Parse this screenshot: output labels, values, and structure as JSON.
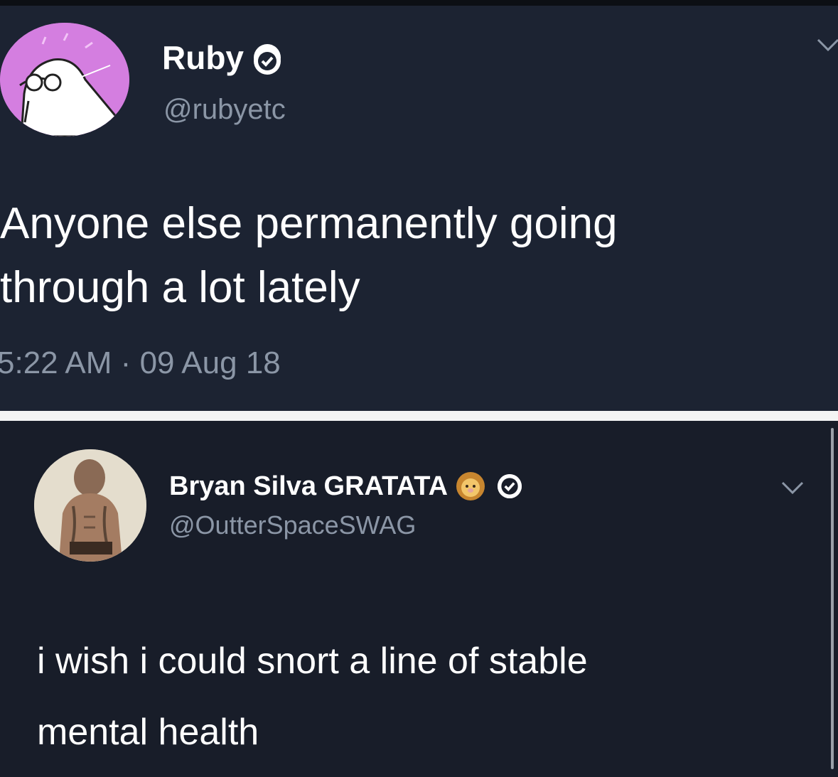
{
  "tweets": [
    {
      "display_name": "Ruby",
      "handle": "@rubyetc",
      "text_lines": [
        "Anyone else permanently going",
        "through a lot lately"
      ],
      "time": "5:22 AM",
      "separator": "·",
      "date": "09 Aug 18",
      "verified": true
    },
    {
      "display_name": "Bryan Silva GRATATA",
      "handle": "@OutterSpaceSWAG",
      "text_lines": [
        "i wish i could snort a line of stable",
        "mental health"
      ],
      "verified": true
    }
  ],
  "icons": {
    "verified": "verified-check-icon",
    "menu": "chevron-down-icon",
    "emoji": "lion-face-emoji"
  },
  "colors": {
    "background_top": "#1c2332",
    "background_bottom": "#181d29",
    "text_primary": "#ffffff",
    "text_secondary": "#8b96a6",
    "avatar_ruby": "#d47ee0"
  }
}
